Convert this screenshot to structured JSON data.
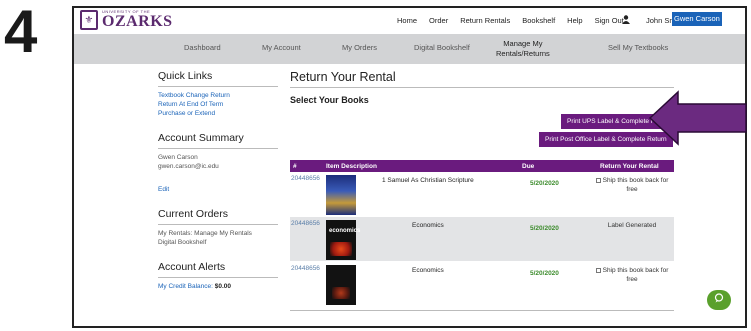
{
  "step_number": "4",
  "brand": {
    "small_text": "UNIVERSITY OF THE",
    "name": "OZARKS"
  },
  "top_nav": [
    "Home",
    "Order",
    "Return Rentals",
    "Bookshelf",
    "Help",
    "Sign Out"
  ],
  "user": {
    "name": "John Smi",
    "badge": "Gwen Carson"
  },
  "sub_nav": {
    "dashboard": "Dashboard",
    "account": "My Account",
    "orders": "My Orders",
    "digital": "Digital Bookshelf",
    "manage_1": "Manage My",
    "manage_2": "Rentals/Returns",
    "sell": "Sell My Textbooks"
  },
  "sidebar": {
    "quick_links_title": "Quick Links",
    "quick_links": [
      "Textbook Change Return",
      "Return At End Of Term",
      "Purchase or Extend"
    ],
    "account_summary_title": "Account Summary",
    "account_name": "Gwen Carson",
    "account_email": "gwen.carson@ic.edu",
    "edit": "Edit",
    "current_orders_title": "Current Orders",
    "current_orders_line1": "My Rentals: Manage My Rentals",
    "current_orders_line2": "Digital Bookshelf",
    "alerts_title": "Account Alerts",
    "credit_label": "My Credit Balance:",
    "credit_value": "$0.00"
  },
  "main": {
    "title": "Return Your Rental",
    "subtitle": "Select Your Books",
    "btn_ups": "Print UPS Label & Complete Return",
    "btn_post": "Print Post Office Label & Complete Return"
  },
  "table": {
    "headers": {
      "num": "#",
      "desc": "Item Description",
      "due": "Due",
      "ret": "Return Your Rental"
    },
    "rows": [
      {
        "isbn": "20448656",
        "desc": "1 Samuel As Christian Scripture",
        "due": "5/20/2020",
        "ret": "Ship this book back for free",
        "cover_text": ""
      },
      {
        "isbn": "20448656",
        "desc": "Economics",
        "due": "5/20/2020",
        "ret": "Label Generated",
        "cover_text": "economics"
      },
      {
        "isbn": "20448656",
        "desc": "Economics",
        "due": "5/20/2020",
        "ret": "Ship this book back for free",
        "cover_text": ""
      }
    ]
  },
  "colors": {
    "brand_purple": "#6a1b7e",
    "arrow_purple": "#6b2a80",
    "link_blue": "#1a63b8",
    "due_green": "#3a8a2a"
  },
  "icons": {
    "user": "user-icon",
    "chat": "chat-icon",
    "arrow": "arrow-left-icon"
  }
}
